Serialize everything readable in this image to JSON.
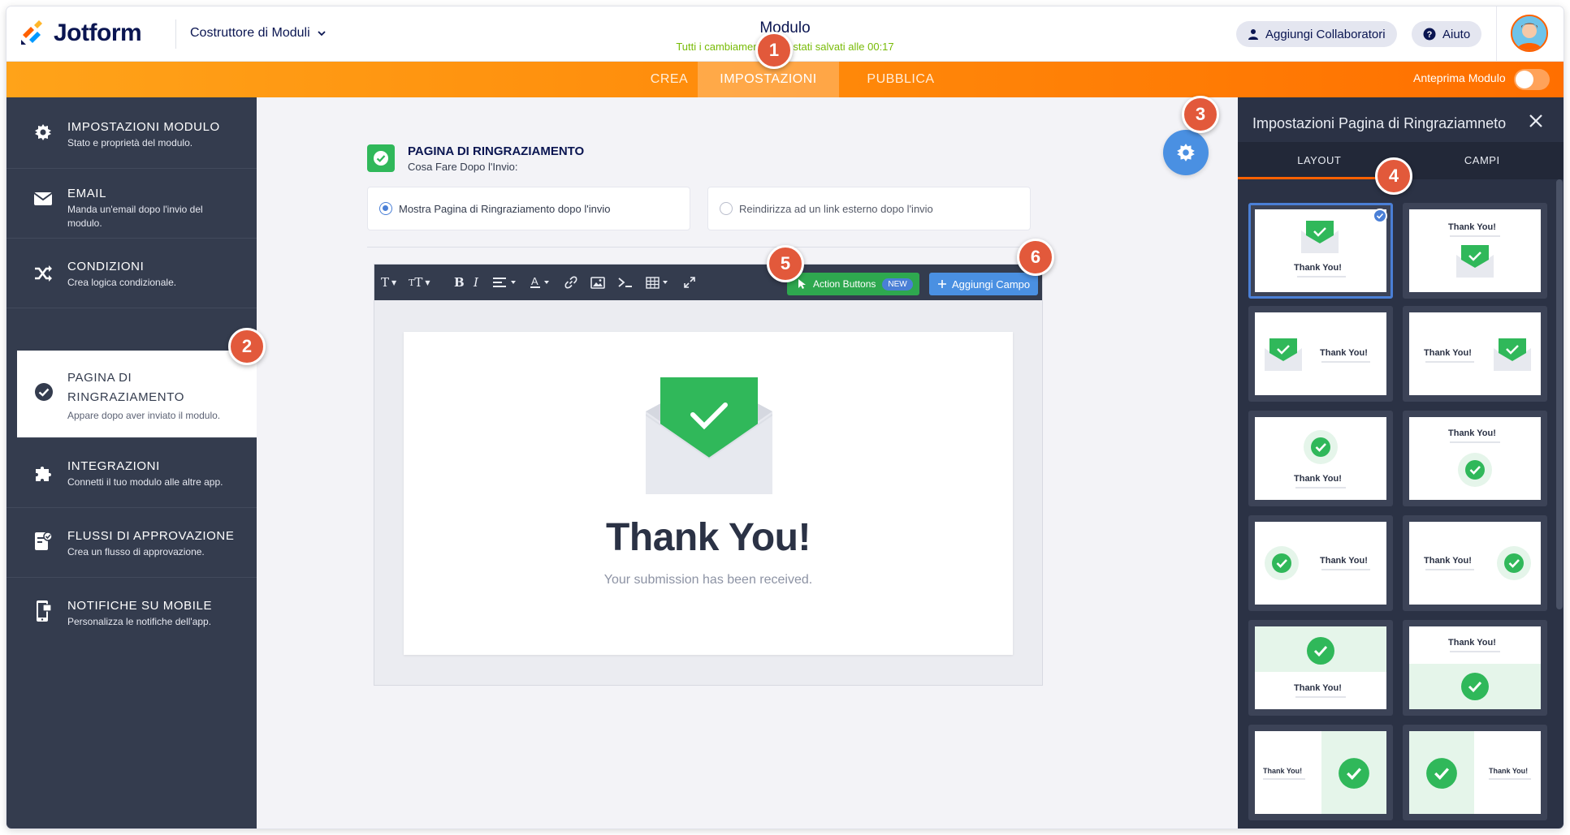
{
  "header": {
    "logo_text": "Jotform",
    "builder_label": "Costruttore di Moduli",
    "form_title": "Modulo",
    "saved_status": "Tutti i cambiamenti sono stati salvati alle 00:17",
    "collaborators_label": "Aggiungi Collaboratori",
    "help_label": "Aiuto"
  },
  "nav": {
    "tabs": [
      {
        "label": "CREA"
      },
      {
        "label": "IMPOSTAZIONI",
        "active": true
      },
      {
        "label": "PUBBLICA"
      }
    ],
    "preview_label": "Anteprima Modulo",
    "preview_on": false
  },
  "sidebar": {
    "items": [
      {
        "title": "IMPOSTAZIONI MODULO",
        "desc": "Stato e proprietà del modulo.",
        "icon": "gear-icon"
      },
      {
        "title": "EMAIL",
        "desc": "Manda un'email dopo l'invio del modulo.",
        "icon": "envelope-icon"
      },
      {
        "title": "CONDIZIONI",
        "desc": "Crea logica condizionale.",
        "icon": "shuffle-icon"
      },
      {
        "title": "PAGINA DI RINGRAZIAMENTO",
        "desc": "Appare dopo aver inviato il modulo.",
        "icon": "check-circle-icon",
        "active": true
      },
      {
        "title": "INTEGRAZIONI",
        "desc": "Connetti il tuo modulo alle altre app.",
        "icon": "puzzle-icon"
      },
      {
        "title": "FLUSSI DI APPROVAZIONE",
        "desc": "Crea un flusso di approvazione.",
        "icon": "approval-icon"
      },
      {
        "title": "NOTIFICHE SU MOBILE",
        "desc": "Personalizza le notifiche dell'app.",
        "icon": "mobile-icon"
      }
    ]
  },
  "main": {
    "section_title": "PAGINA DI RINGRAZIAMENTO",
    "section_sub": "Cosa Fare Dopo l'Invio:",
    "option_show": "Mostra Pagina di Ringraziamento dopo l'invio",
    "option_redirect": "Reindirizza ad un link esterno dopo l'invio",
    "action_buttons_label": "Action Buttons",
    "new_badge": "NEW",
    "add_field_label": "Aggiungi Campo",
    "thank_you_title": "Thank You!",
    "thank_you_sub": "Your submission has been received."
  },
  "right_panel": {
    "title": "Impostazioni Pagina di Ringraziamneto",
    "tabs": [
      "LAYOUT",
      "CAMPI"
    ],
    "tile_text": "Thank You!"
  },
  "markers": [
    "1",
    "2",
    "3",
    "4",
    "5",
    "6"
  ],
  "colors": {
    "brand_orange": "#ff6100",
    "sidebar_bg": "#343c4e",
    "success_green": "#30b85a",
    "accent_blue": "#4a90e2",
    "marker_red": "#e2593b"
  }
}
